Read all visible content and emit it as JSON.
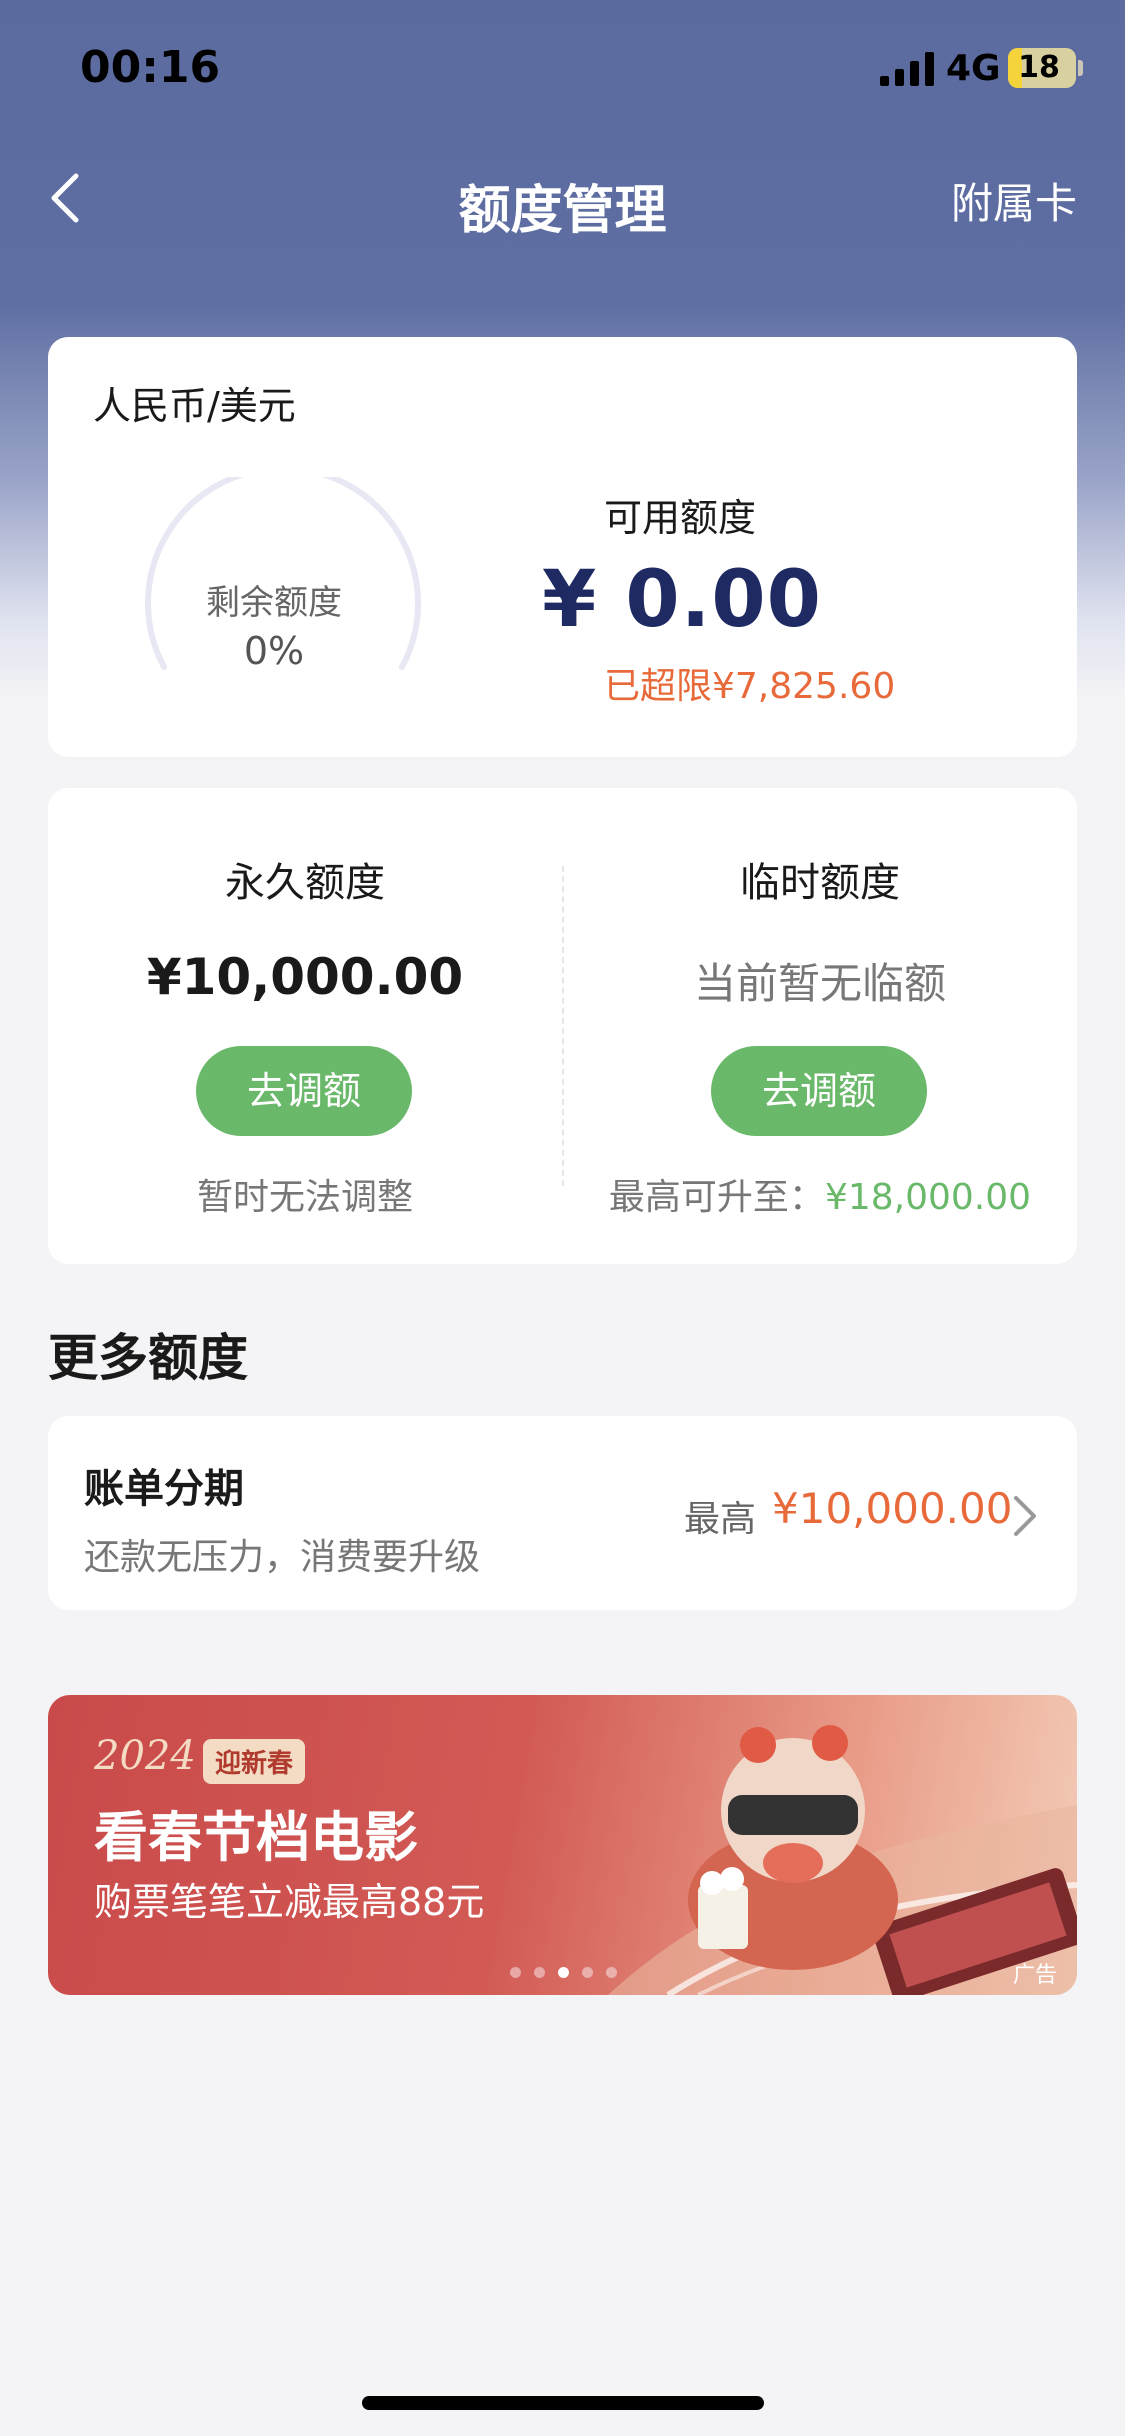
{
  "status_bar": {
    "time": "00:16",
    "network": "4G",
    "battery": "18"
  },
  "nav": {
    "title": "额度管理",
    "right_action": "附属卡"
  },
  "limit_card": {
    "currency": "人民币/美元",
    "gauge_label": "剩余额度",
    "gauge_value": "0%",
    "gauge_fraction": 0,
    "available_label": "可用额度",
    "available_amount": "¥ 0.00",
    "over_limit": "已超限¥7,825.60"
  },
  "quota_card": {
    "permanent": {
      "title": "永久额度",
      "amount": "¥10,000.00",
      "button": "去调额",
      "note": "暂时无法调整"
    },
    "temporary": {
      "title": "临时额度",
      "status": "当前暂无临额",
      "button": "去调额",
      "note_prefix": "最高可升至：",
      "note_amount": "¥18,000.00"
    }
  },
  "more_section": {
    "title": "更多额度"
  },
  "installment": {
    "title": "账单分期",
    "subtitle": "还款无压力，消费要升级",
    "prefix": "最高",
    "amount": "¥10,000.00"
  },
  "banner": {
    "year": "2024",
    "badge": "迎新春",
    "title": "看春节档电影",
    "subtitle": "购票笔笔立减最高88元",
    "ad_tag": "广告",
    "dots_total": 5,
    "dots_active_index": 2
  },
  "colors": {
    "header": "#5b6ba0",
    "accent_green": "#6ab86a",
    "accent_orange": "#e86a3a",
    "amount_navy": "#1f2a63"
  },
  "icons": {
    "back": "chevron-left-icon",
    "chevron": "chevron-right-icon",
    "signal": "signal-icon",
    "battery": "battery-icon"
  }
}
